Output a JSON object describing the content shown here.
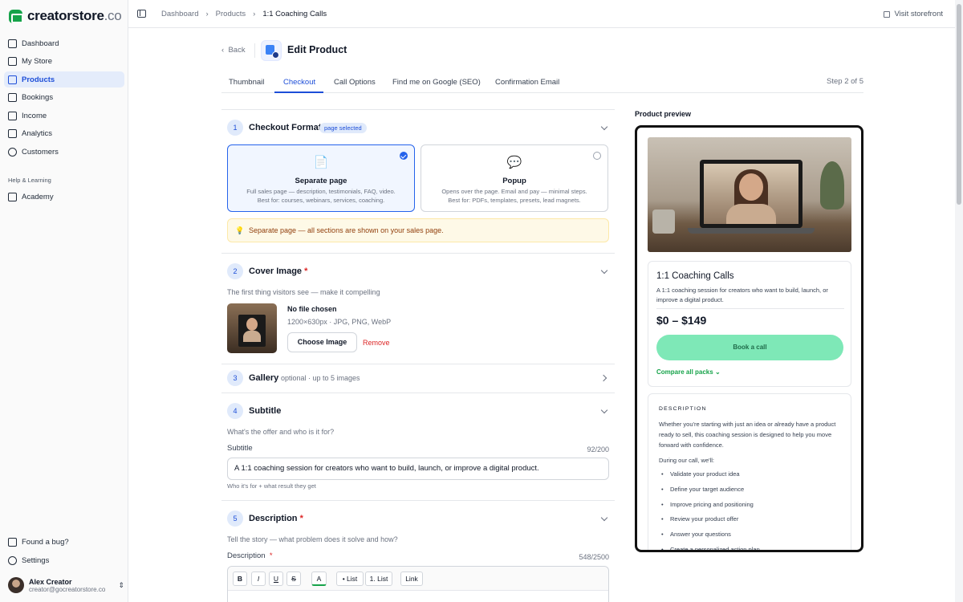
{
  "brand": {
    "name": "creatorstore",
    "suffix": ".co",
    "color": "#16a34a"
  },
  "sidebar": {
    "items": [
      {
        "label": "Dashboard",
        "icon": "dashboard-icon"
      },
      {
        "label": "My Store",
        "icon": "store-icon"
      },
      {
        "label": "Products",
        "icon": "products-icon",
        "active": true
      },
      {
        "label": "Bookings",
        "icon": "calendar-icon"
      },
      {
        "label": "Income",
        "icon": "wallet-icon"
      },
      {
        "label": "Analytics",
        "icon": "chart-icon"
      },
      {
        "label": "Customers",
        "icon": "users-icon"
      }
    ],
    "section_label": "Help & Learning",
    "learning": [
      {
        "label": "Academy",
        "icon": "graduation-cap-icon"
      }
    ],
    "bottom": [
      {
        "label": "Found a bug?",
        "icon": "message-icon"
      },
      {
        "label": "Settings",
        "icon": "gear-icon"
      }
    ],
    "user": {
      "name": "Alex Creator",
      "email": "creator@gocreatorstore.co"
    }
  },
  "topbar": {
    "breadcrumbs": [
      "Dashboard",
      "Products",
      "1:1 Coaching Calls"
    ],
    "separator": "›",
    "visit": "Visit storefront"
  },
  "header": {
    "back": "Back",
    "title": "Edit Product"
  },
  "tabs": [
    "Thumbnail",
    "Checkout",
    "Call Options",
    "Find me on Google (SEO)",
    "Confirmation Email"
  ],
  "active_tab": "Checkout",
  "step": "Step 2 of 5",
  "sections": {
    "checkout_format": {
      "num": "1",
      "title": "Checkout Format",
      "badge": "page selected",
      "options": [
        {
          "emoji": "📄",
          "title": "Separate page",
          "line1": "Full sales page — description, testimonials, FAQ, video.",
          "line2": "Best for: courses, webinars, services, coaching.",
          "selected": true
        },
        {
          "emoji": "💬",
          "title": "Popup",
          "line1": "Opens over the page. Email and pay — minimal steps.",
          "line2": "Best for: PDFs, templates, presets, lead magnets.",
          "selected": false
        }
      ],
      "tip_icon": "💡",
      "tip": "Separate page — all sections are shown on your sales page."
    },
    "cover_image": {
      "num": "2",
      "title": "Cover Image",
      "required": "*",
      "help": "The first thing visitors see — make it compelling",
      "file": "No file chosen",
      "specs": "1200×630px · JPG, PNG, WebP",
      "choose": "Choose Image",
      "remove": "Remove"
    },
    "gallery": {
      "num": "3",
      "title": "Gallery",
      "meta": "optional · up to 5 images"
    },
    "subtitle": {
      "num": "4",
      "title": "Subtitle",
      "help": "What's the offer and who is it for?",
      "label": "Subtitle",
      "count": "92/200",
      "value": "A 1:1 coaching session for creators who want to build, launch, or improve a digital product.",
      "hint": "Who it's for + what result they get"
    },
    "description": {
      "num": "5",
      "title": "Description",
      "required": "*",
      "help": "Tell the story — what problem does it solve and how?",
      "label": "Description",
      "count": "548/2500",
      "toolbar": [
        "B",
        "I",
        "U",
        "S",
        "A",
        "• List",
        "1. List",
        "Link"
      ]
    }
  },
  "preview": {
    "label": "Product preview",
    "title": "1:1 Coaching Calls",
    "subtitle": "A 1:1 coaching session for creators who want to build, launch, or improve a digital product.",
    "price": "$0 – $149",
    "cta": "Book a call",
    "compare": "Compare all packs",
    "desc_heading": "DESCRIPTION",
    "desc": "Whether you're starting with just an idea or already have a product ready to sell, this coaching session is designed to help you move forward with confidence.",
    "during": "During our call, we'll:",
    "bullets": [
      "Validate your product idea",
      "Define your target audience",
      "Improve pricing and positioning",
      "Review your product offer",
      "Answer your questions",
      "Create a personalized action plan"
    ]
  }
}
